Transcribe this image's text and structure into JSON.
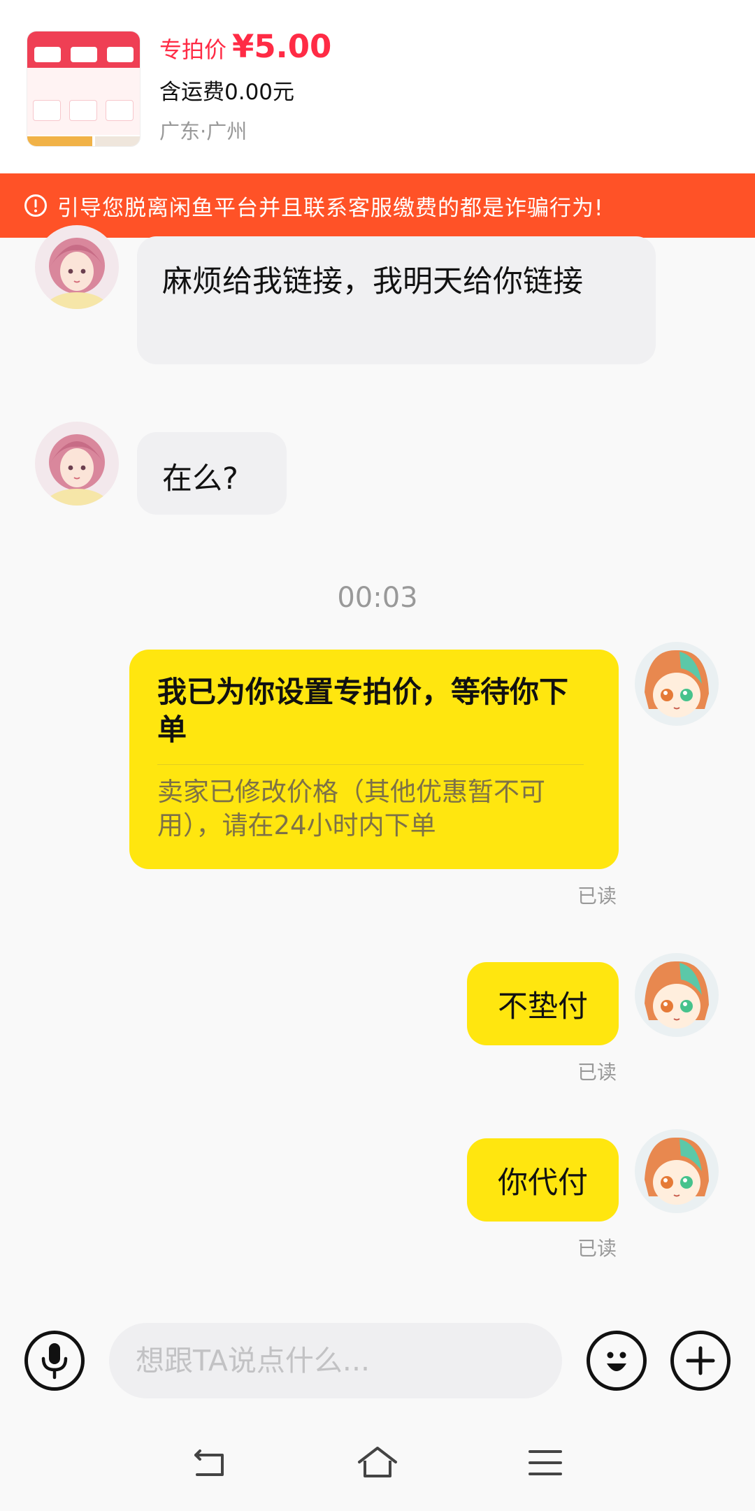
{
  "product": {
    "price_label": "专拍价",
    "price_value": "¥5.00",
    "shipping": "含运费0.00元",
    "location": "广东·广州"
  },
  "warning": {
    "icon": "alert-circle-icon",
    "text": "引导您脱离闲鱼平台并且联系客服缴费的都是诈骗行为!"
  },
  "messages": {
    "m1_text": "麻烦给我链接，我明天给你链接",
    "m2_text": "在么?",
    "timestamp": "00:03",
    "card_title": "我已为你设置专拍价，等待你下单",
    "card_sub": "卖家已修改价格（其他优惠暂不可用），请在24小时内下单",
    "card_read": "已读",
    "m4_text": "不垫付",
    "m4_read": "已读",
    "m5_text": "你代付",
    "m5_read": "已读"
  },
  "input_bar": {
    "placeholder": "想跟TA说点什么...",
    "voice_icon": "microphone-icon",
    "emoji_icon": "emoji-icon",
    "plus_icon": "plus-icon"
  },
  "nav": {
    "back_icon": "back-icon",
    "home_icon": "home-icon",
    "menu_icon": "menu-icon"
  },
  "colors": {
    "price": "#ff2b45",
    "banner": "#ff5227",
    "bubble_out": "#ffe60f",
    "bubble_in": "#f0f0f2"
  }
}
